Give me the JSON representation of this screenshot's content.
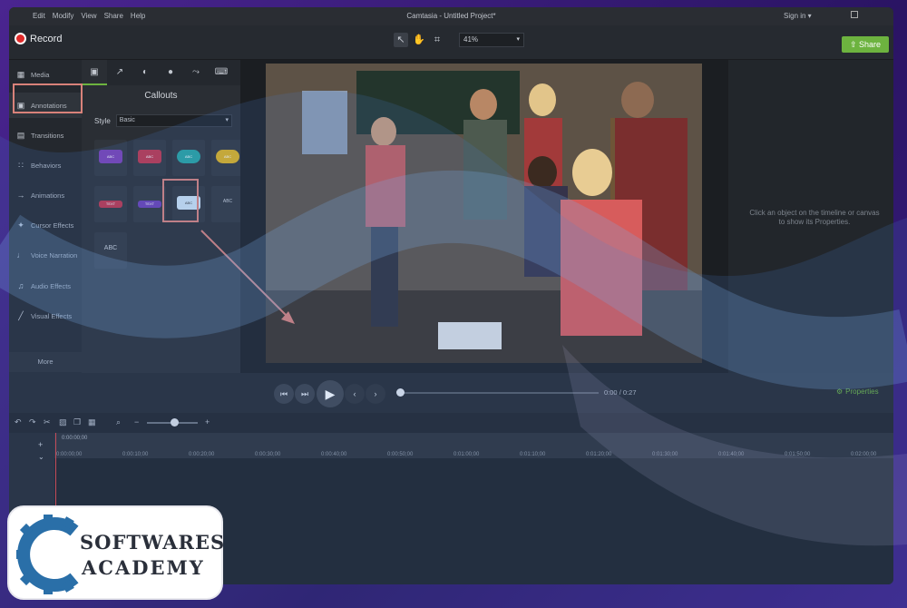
{
  "menu": {
    "items": [
      "Edit",
      "Modify",
      "View",
      "Share",
      "Help"
    ],
    "title": "Camtasia - Untitled Project*",
    "sign_in": "Sign in ▾"
  },
  "toolbar": {
    "record_label": "Record",
    "zoom_value": "41%",
    "share_label": "Share"
  },
  "sidebar": {
    "items": [
      {
        "label": "Media",
        "icon": "film-icon"
      },
      {
        "label": "Annotations",
        "icon": "annotation-icon"
      },
      {
        "label": "Transitions",
        "icon": "transition-icon"
      },
      {
        "label": "Behaviors",
        "icon": "behavior-icon"
      },
      {
        "label": "Animations",
        "icon": "animation-icon"
      },
      {
        "label": "Cursor Effects",
        "icon": "cursor-icon"
      },
      {
        "label": "Voice Narration",
        "icon": "microphone-icon"
      },
      {
        "label": "Audio Effects",
        "icon": "audio-icon"
      },
      {
        "label": "Visual Effects",
        "icon": "wand-icon"
      }
    ],
    "more_label": "More"
  },
  "panel": {
    "title": "Callouts",
    "style_label": "Style",
    "style_value": "Basic",
    "callouts": [
      {
        "label": "ABC",
        "color": "#7b3fb5"
      },
      {
        "label": "ABC",
        "color": "#c0344a"
      },
      {
        "label": "ABC",
        "color": "#27a3a0"
      },
      {
        "label": "ABC",
        "color": "#e0b21d"
      },
      {
        "label": "TEXT",
        "color": "#c0344a"
      },
      {
        "label": "TEXT",
        "color": "#6b3fb5"
      },
      {
        "label": "ABC",
        "color": "#cfe3f4"
      },
      {
        "label": "ABC",
        "color": ""
      },
      {
        "label": "ABC",
        "color": ""
      }
    ]
  },
  "properties": {
    "hint": "Click an object on the timeline or canvas to show its Properties.",
    "button_label": "Properties"
  },
  "playback": {
    "time_current": "0:00",
    "time_separator": "/",
    "time_total": "0:27"
  },
  "timeline": {
    "playhead": "0:00:00;00",
    "ticks": [
      "0:00:00;00",
      "0:00:10;00",
      "0:00:20;00",
      "0:00:30;00",
      "0:00:40;00",
      "0:00:50;00",
      "0:01:00;00",
      "0:01:10;00",
      "0:01:20;00",
      "0:01:30;00",
      "0:01:40;00",
      "0:01:50;00",
      "0:02:00;00"
    ]
  },
  "logo": {
    "line1": "SOFTWARES",
    "line2": "ACADEMY"
  },
  "colors": {
    "accent": "#6db33f",
    "record": "#e02a2a",
    "highlight": "#d9827a"
  }
}
